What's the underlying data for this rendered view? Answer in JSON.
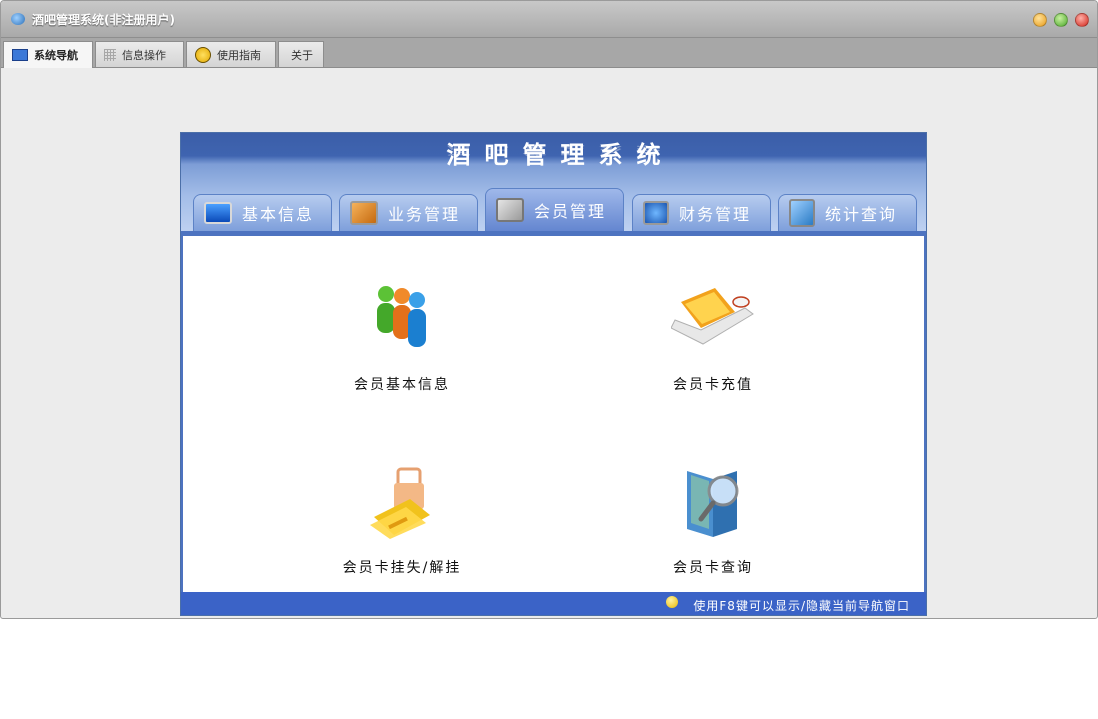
{
  "window": {
    "title": "酒吧管理系统(非注册用户)",
    "window_buttons": [
      "minimize",
      "maximize",
      "close"
    ]
  },
  "top_tabs": [
    {
      "label": "系统导航",
      "icon": "monitor-icon",
      "active": true
    },
    {
      "label": "信息操作",
      "icon": "grid-icon",
      "active": false
    },
    {
      "label": "使用指南",
      "icon": "guide-icon",
      "active": false
    },
    {
      "label": "关于",
      "icon": "",
      "active": false
    }
  ],
  "panel": {
    "title": "酒吧管理系统",
    "section_tabs": [
      {
        "label": "基本信息",
        "icon": "monitor-icon",
        "active": false
      },
      {
        "label": "业务管理",
        "icon": "feed-icon",
        "active": false
      },
      {
        "label": "会员管理",
        "icon": "brush-icon",
        "active": true
      },
      {
        "label": "财务管理",
        "icon": "globe-icon",
        "active": false
      },
      {
        "label": "统计查询",
        "icon": "search-icon",
        "active": false
      }
    ],
    "functions": [
      {
        "label": "会员基本信息",
        "icon": "people-icon"
      },
      {
        "label": "会员卡充值",
        "icon": "laptop-icon"
      },
      {
        "label": "会员卡挂失/解挂",
        "icon": "card-lock-icon"
      },
      {
        "label": "会员卡查询",
        "icon": "folder-search-icon"
      }
    ],
    "status_tip": "使用F8键可以显示/隐藏当前导航窗口"
  },
  "colors": {
    "panel_blue": "#3b63c7",
    "tab_bar_gray": "#a7a7a7"
  }
}
